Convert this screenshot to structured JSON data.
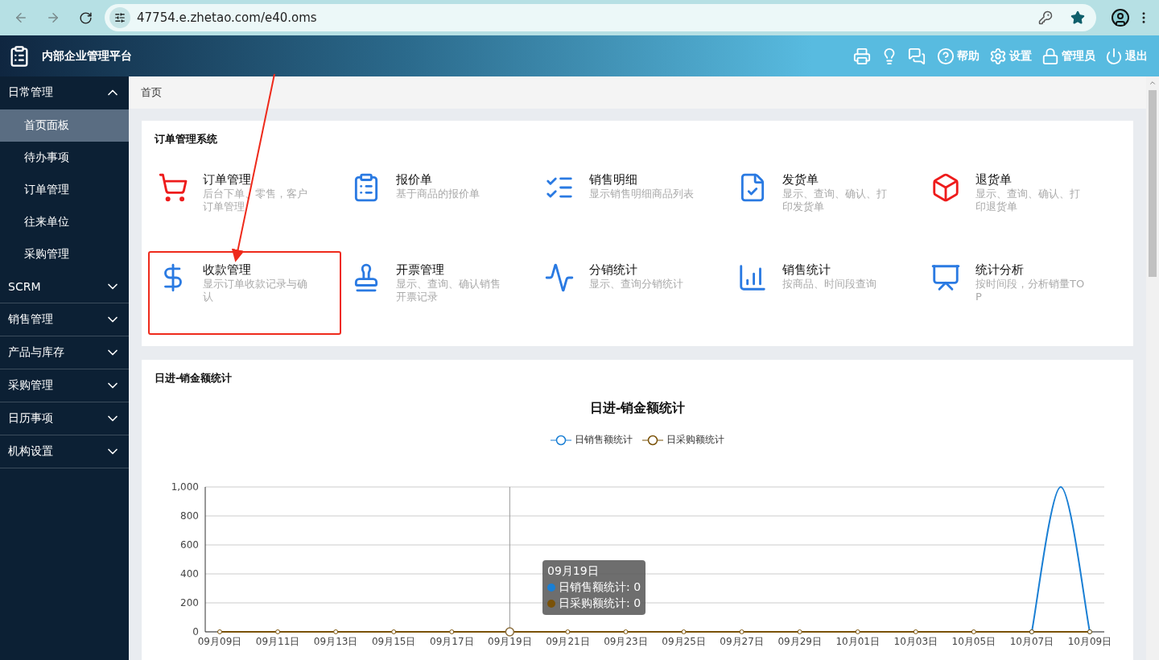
{
  "browser": {
    "url": "47754.e.zhetao.com/e40.oms"
  },
  "header": {
    "title": "内部企业管理平台",
    "actions": [
      {
        "kind": "icon"
      },
      {
        "kind": "icon"
      },
      {
        "kind": "icon"
      },
      {
        "kind": "text",
        "label": "帮助"
      },
      {
        "kind": "text",
        "label": "设置"
      },
      {
        "kind": "text",
        "label": "管理员"
      },
      {
        "kind": "text",
        "label": "退出"
      }
    ]
  },
  "sidebar": {
    "groups": [
      {
        "label": "日常管理",
        "expanded": true,
        "children": [
          {
            "label": "首页面板",
            "selected": true
          },
          {
            "label": "待办事项",
            "selected": false
          },
          {
            "label": "订单管理",
            "selected": false
          },
          {
            "label": "往来单位",
            "selected": false
          },
          {
            "label": "采购管理",
            "selected": false
          }
        ]
      },
      {
        "label": "SCRM",
        "expanded": false
      },
      {
        "label": "销售管理",
        "expanded": false
      },
      {
        "label": "产品与库存",
        "expanded": false
      },
      {
        "label": "采购管理",
        "expanded": false
      },
      {
        "label": "日历事项",
        "expanded": false
      },
      {
        "label": "机构设置",
        "expanded": false
      }
    ]
  },
  "breadcrumb": "首页",
  "modules": {
    "title": "订单管理系统",
    "items": [
      {
        "title": "订单管理",
        "desc": "后台下单、零售，客户订单管理",
        "highlighted": false
      },
      {
        "title": "报价单",
        "desc": "基于商品的报价单",
        "highlighted": false
      },
      {
        "title": "销售明细",
        "desc": "显示销售明细商品列表",
        "highlighted": false
      },
      {
        "title": "发货单",
        "desc": "显示、查询、确认、打印发货单",
        "highlighted": false
      },
      {
        "title": "退货单",
        "desc": "显示、查询、确认、打印退货单",
        "highlighted": false
      },
      {
        "title": "收款管理",
        "desc": "显示订单收款记录与确认",
        "highlighted": true
      },
      {
        "title": "开票管理",
        "desc": "显示、查询、确认销售开票记录",
        "highlighted": false
      },
      {
        "title": "分销统计",
        "desc": "显示、查询分销统计",
        "highlighted": false
      },
      {
        "title": "销售统计",
        "desc": "按商品、时间段查询",
        "highlighted": false
      },
      {
        "title": "统计分析",
        "desc": "按时间段，分析销量TOP",
        "highlighted": false
      }
    ]
  },
  "stats": {
    "title": "日进-销金额统计",
    "chart_data": {
      "type": "line",
      "title": "日进-销金额统计",
      "categories": [
        "09月09日",
        null,
        "09月11日",
        null,
        "09月13日",
        null,
        "09月15日",
        null,
        "09月17日",
        null,
        "09月19日",
        null,
        "09月21日",
        null,
        "09月23日",
        null,
        "09月25日",
        null,
        "09月27日",
        null,
        "09月29日",
        null,
        "10月01日",
        null,
        "10月03日",
        null,
        "10月05日",
        null,
        "10月07日",
        null,
        "10月09日"
      ],
      "ylim": [
        0,
        1000
      ],
      "grid": true,
      "ref_lines": [
        {
          "axis": "x",
          "value": "09月19日"
        }
      ],
      "yticks": [
        0,
        200,
        400,
        600,
        800,
        {
          "value": 1000,
          "label": "1,000"
        }
      ],
      "series": [
        {
          "name": "日销售额统计",
          "color": "#1a7fd4",
          "values": [
            null,
            null,
            null,
            null,
            null,
            null,
            null,
            null,
            null,
            null,
            null,
            null,
            null,
            null,
            null,
            null,
            null,
            null,
            null,
            null,
            null,
            null,
            null,
            null,
            null,
            null,
            null,
            null,
            0,
            1000,
            0
          ]
        },
        {
          "name": "日采购额统计",
          "color": "#7a5208",
          "values": [
            0,
            0,
            0,
            0,
            0,
            0,
            0,
            0,
            0,
            0,
            0,
            0,
            0,
            0,
            0,
            0,
            0,
            0,
            0,
            0,
            0,
            0,
            0,
            0,
            0,
            0,
            0,
            0,
            0,
            0,
            0
          ]
        }
      ]
    },
    "tooltip": {
      "title": "09月19日",
      "rows": [
        {
          "text": "日销售额统计: 0",
          "color": "#1a7fd4"
        },
        {
          "text": "日采购额统计: 0",
          "color": "#7a5208"
        }
      ]
    }
  }
}
